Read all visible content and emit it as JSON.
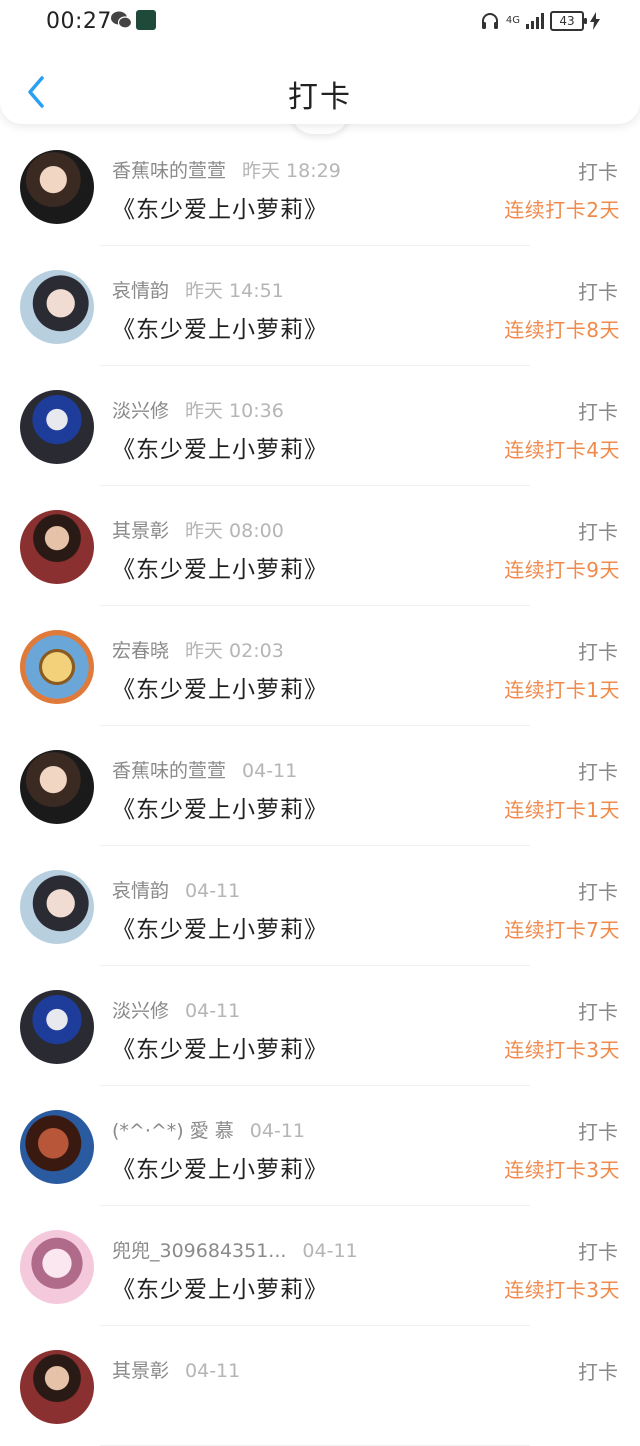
{
  "status_bar": {
    "time": "00:27",
    "battery": "43",
    "network": "4G"
  },
  "header": {
    "title": "打卡"
  },
  "colors": {
    "accent": "#2aa0f0",
    "streak": "#f08a4b"
  },
  "items": [
    {
      "user": "香蕉味的萱萱",
      "time": "昨天 18:29",
      "book": "《东少爱上小萝莉》",
      "action": "打卡",
      "streak": "连续打卡2天",
      "avatar": "a1"
    },
    {
      "user": "哀情韵",
      "time": "昨天 14:51",
      "book": "《东少爱上小萝莉》",
      "action": "打卡",
      "streak": "连续打卡8天",
      "avatar": "a2"
    },
    {
      "user": "淡兴修",
      "time": "昨天 10:36",
      "book": "《东少爱上小萝莉》",
      "action": "打卡",
      "streak": "连续打卡4天",
      "avatar": "a3"
    },
    {
      "user": "其景彰",
      "time": "昨天 08:00",
      "book": "《东少爱上小萝莉》",
      "action": "打卡",
      "streak": "连续打卡9天",
      "avatar": "a4"
    },
    {
      "user": "宏春晓",
      "time": "昨天 02:03",
      "book": "《东少爱上小萝莉》",
      "action": "打卡",
      "streak": "连续打卡1天",
      "avatar": "a5"
    },
    {
      "user": "香蕉味的萱萱",
      "time": "04-11",
      "book": "《东少爱上小萝莉》",
      "action": "打卡",
      "streak": "连续打卡1天",
      "avatar": "a1"
    },
    {
      "user": "哀情韵",
      "time": "04-11",
      "book": "《东少爱上小萝莉》",
      "action": "打卡",
      "streak": "连续打卡7天",
      "avatar": "a2"
    },
    {
      "user": "淡兴修",
      "time": "04-11",
      "book": "《东少爱上小萝莉》",
      "action": "打卡",
      "streak": "连续打卡3天",
      "avatar": "a3"
    },
    {
      "user": "(*^·^*) 愛 慕",
      "time": "04-11",
      "book": "《东少爱上小萝莉》",
      "action": "打卡",
      "streak": "连续打卡3天",
      "avatar": "a6"
    },
    {
      "user": "兜兜_309684351...",
      "time": "04-11",
      "book": "《东少爱上小萝莉》",
      "action": "打卡",
      "streak": "连续打卡3天",
      "avatar": "a7"
    },
    {
      "user": "其景彰",
      "time": "04-11",
      "book": "",
      "action": "打卡",
      "streak": "",
      "avatar": "a4"
    }
  ]
}
